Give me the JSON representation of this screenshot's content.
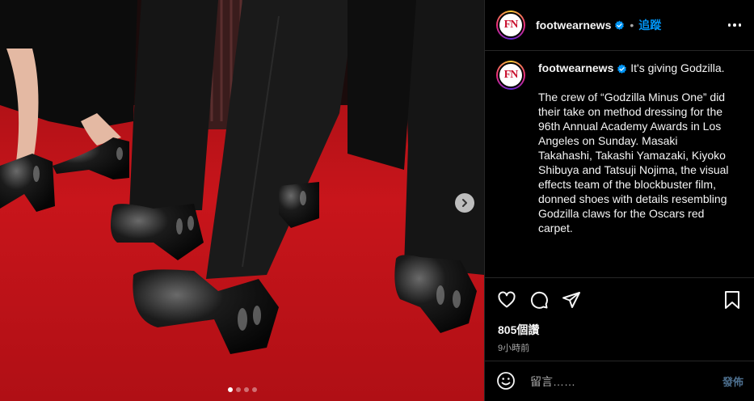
{
  "post": {
    "username": "footwearnews",
    "follow_label": "追蹤",
    "separator": "•",
    "avatar_text": "FN",
    "caption": {
      "username": "footwearnews",
      "lead": "It's giving Godzilla.",
      "body": "The crew of “Godzilla Minus One” did their take on method dressing for the 96th Annual Academy Awards in Los Angeles on Sunday. Masaki Takahashi, Takashi Yamazaki, Kiyoko Shibuya and Tatsuji Nojima, the visual effects team of the blockbuster film, donned shoes with details resembling Godzilla claws for the Oscars red carpet."
    },
    "likes": "805個讚",
    "time": "9小時前",
    "comment": {
      "placeholder": "留言……",
      "post_label": "發佈"
    }
  },
  "carousel": {
    "count": 4,
    "active_index": 0
  },
  "icons": {
    "verified": "verified-badge-icon",
    "more": "more-options-icon",
    "like": "heart-icon",
    "comment": "comment-bubble-icon",
    "share": "paper-plane-icon",
    "save": "bookmark-icon",
    "emoji": "emoji-smile-icon",
    "next": "chevron-right-icon"
  },
  "colors": {
    "accent": "#0095f6",
    "verified": "#0095f6",
    "post_disabled": "#4d6f8e",
    "carpet": "#c1141a"
  }
}
